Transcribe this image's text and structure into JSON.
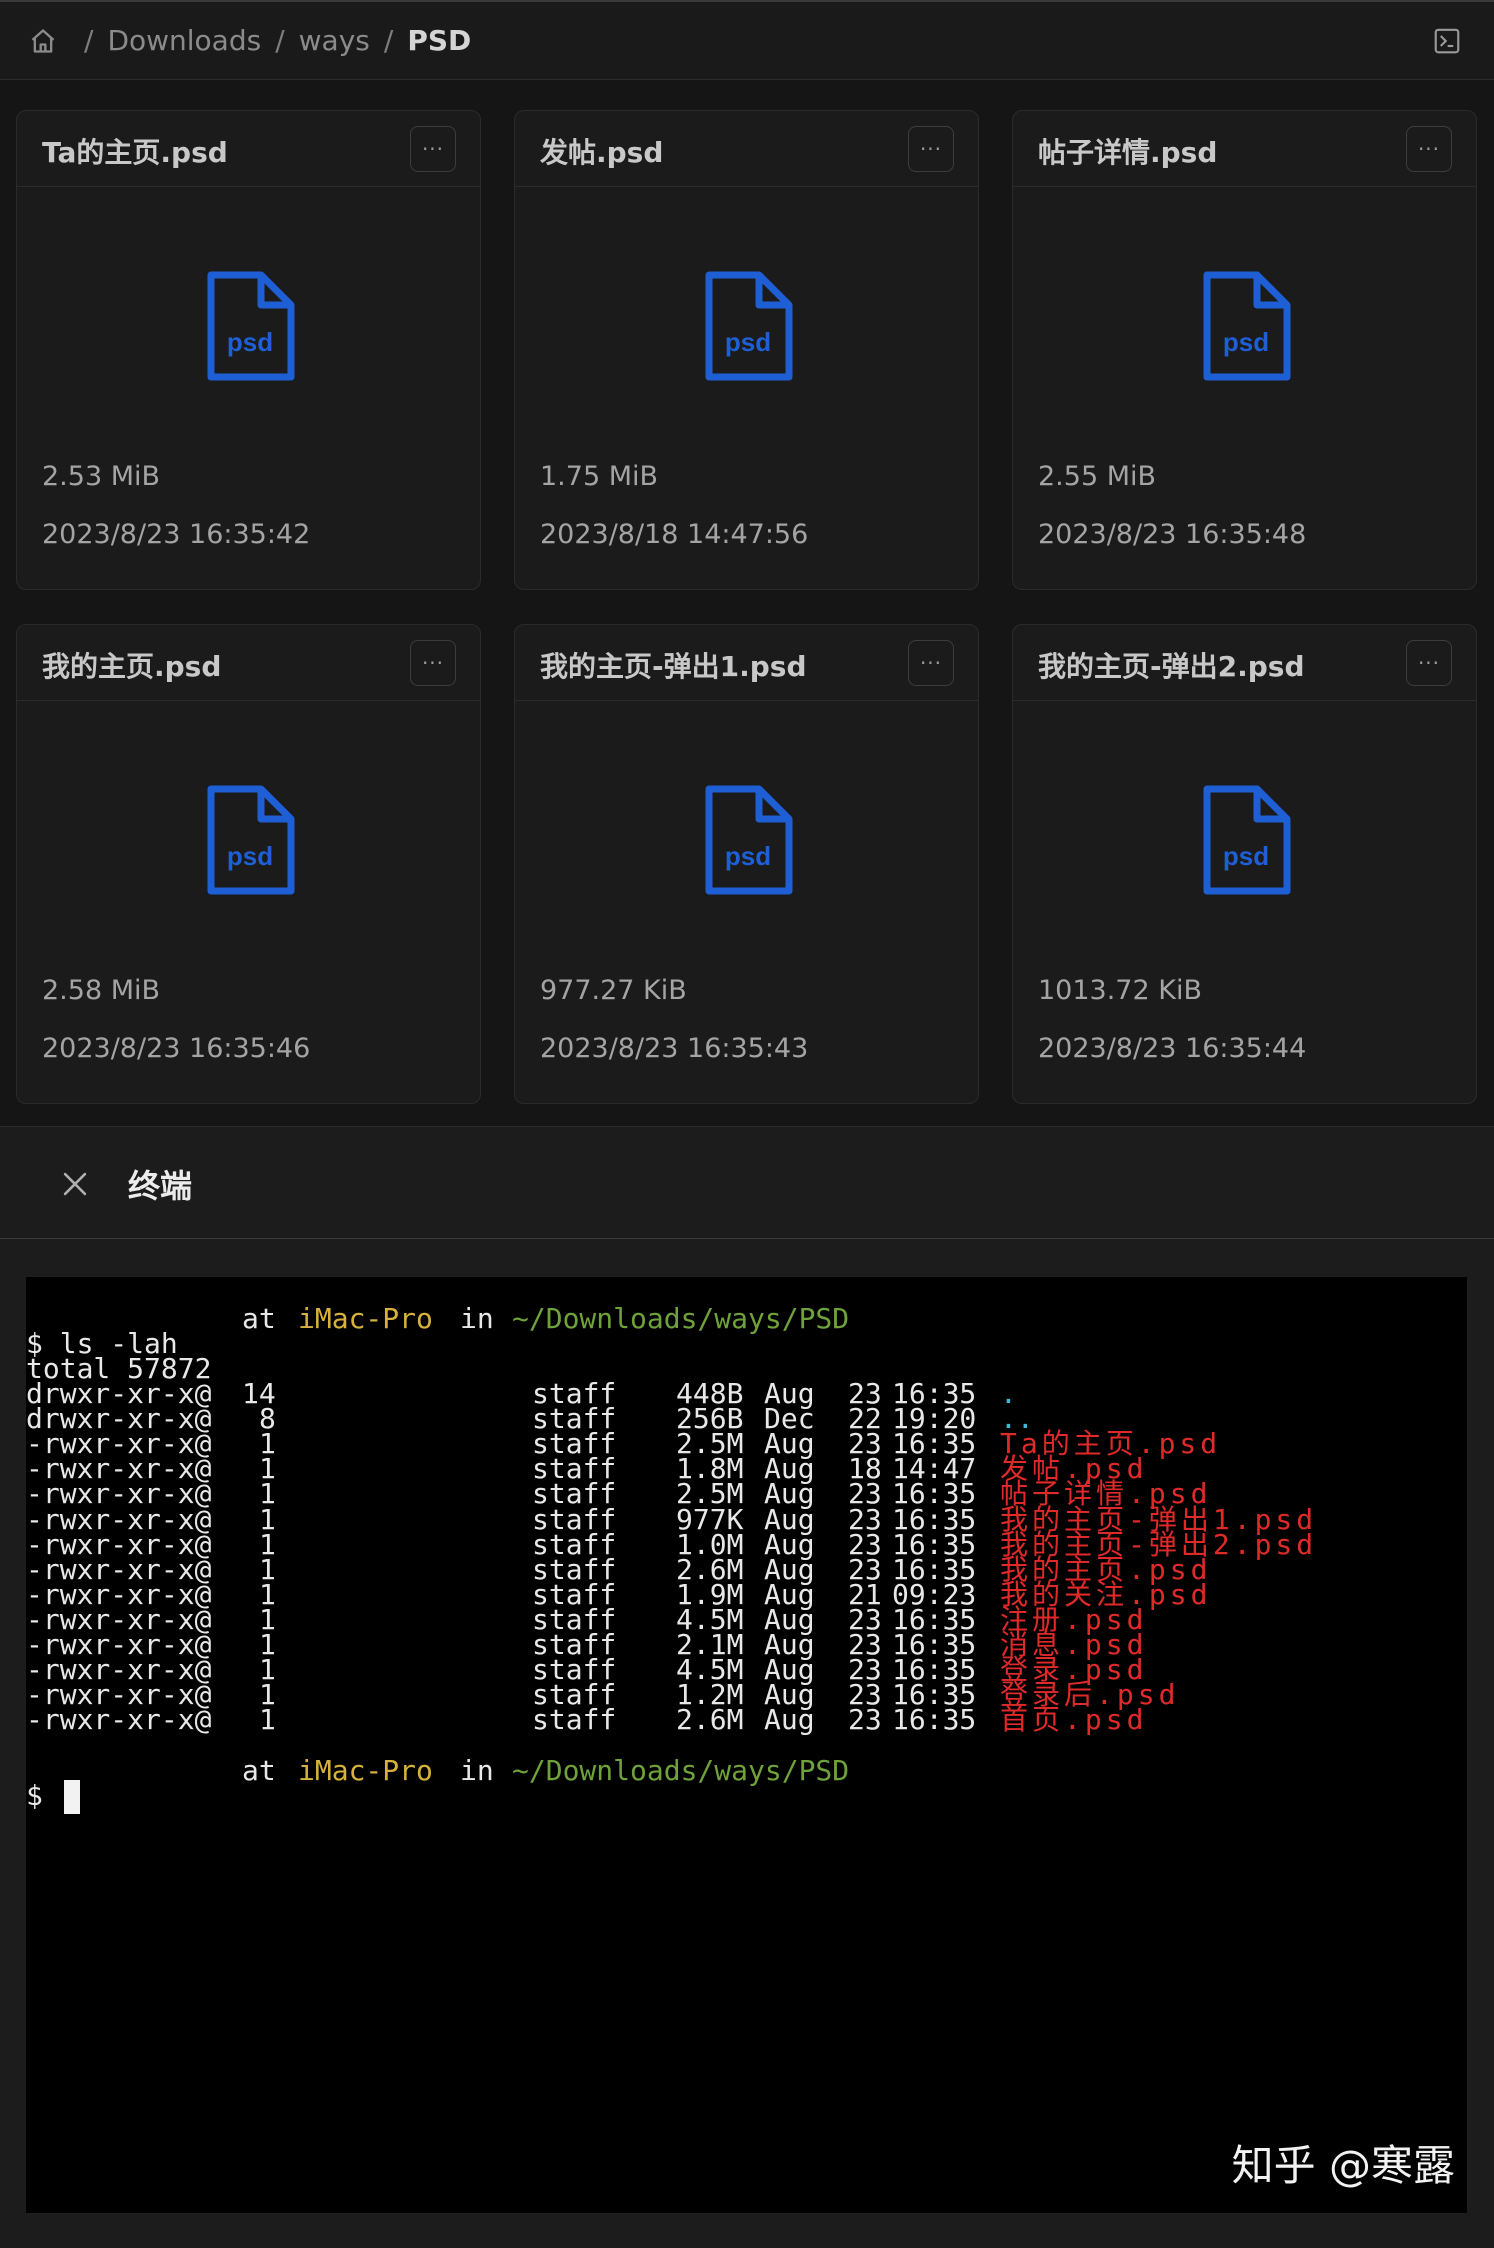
{
  "breadcrumb": {
    "separator": "/",
    "items": [
      "Downloads",
      "ways",
      "PSD"
    ]
  },
  "files": [
    {
      "name": "Ta的主页.psd",
      "size": "2.53 MiB",
      "modified": "2023/8/23 16:35:42",
      "icon": "psd"
    },
    {
      "name": "发帖.psd",
      "size": "1.75 MiB",
      "modified": "2023/8/18 14:47:56",
      "icon": "psd"
    },
    {
      "name": "帖子详情.psd",
      "size": "2.55 MiB",
      "modified": "2023/8/23 16:35:48",
      "icon": "psd"
    },
    {
      "name": "我的主页.psd",
      "size": "2.58 MiB",
      "modified": "2023/8/23 16:35:46",
      "icon": "psd"
    },
    {
      "name": "我的主页-弹出1.psd",
      "size": "977.27 KiB",
      "modified": "2023/8/23 16:35:43",
      "icon": "psd"
    },
    {
      "name": "我的主页-弹出2.psd",
      "size": "1013.72 KiB",
      "modified": "2023/8/23 16:35:44",
      "icon": "psd"
    }
  ],
  "card_menu_label": "···",
  "terminal": {
    "title": "终端",
    "prompt": {
      "at": "at",
      "host": "iMac-Pro",
      "in": "in",
      "path": "~/Downloads/ways/PSD"
    },
    "command_line": "$ ls -lah",
    "total": "total 57872",
    "rows": [
      {
        "perm": "drwxr-xr-x@",
        "links": "14",
        "group": "staff",
        "size": "448B",
        "month": "Aug",
        "day": "23",
        "time": "16:35",
        "name": "."
      },
      {
        "perm": "drwxr-xr-x@",
        "links": "8",
        "group": "staff",
        "size": "256B",
        "month": "Dec",
        "day": "22",
        "time": "19:20",
        "name": ".."
      },
      {
        "perm": "-rwxr-xr-x@",
        "links": "1",
        "group": "staff",
        "size": "2.5M",
        "month": "Aug",
        "day": "23",
        "time": "16:35",
        "name": "Ta的主页.psd"
      },
      {
        "perm": "-rwxr-xr-x@",
        "links": "1",
        "group": "staff",
        "size": "1.8M",
        "month": "Aug",
        "day": "18",
        "time": "14:47",
        "name": "发帖.psd"
      },
      {
        "perm": "-rwxr-xr-x@",
        "links": "1",
        "group": "staff",
        "size": "2.5M",
        "month": "Aug",
        "day": "23",
        "time": "16:35",
        "name": "帖子详情.psd"
      },
      {
        "perm": "-rwxr-xr-x@",
        "links": "1",
        "group": "staff",
        "size": "977K",
        "month": "Aug",
        "day": "23",
        "time": "16:35",
        "name": "我的主页-弹出1.psd"
      },
      {
        "perm": "-rwxr-xr-x@",
        "links": "1",
        "group": "staff",
        "size": "1.0M",
        "month": "Aug",
        "day": "23",
        "time": "16:35",
        "name": "我的主页-弹出2.psd"
      },
      {
        "perm": "-rwxr-xr-x@",
        "links": "1",
        "group": "staff",
        "size": "2.6M",
        "month": "Aug",
        "day": "23",
        "time": "16:35",
        "name": "我的主页.psd"
      },
      {
        "perm": "-rwxr-xr-x@",
        "links": "1",
        "group": "staff",
        "size": "1.9M",
        "month": "Aug",
        "day": "21",
        "time": "09:23",
        "name": "我的关注.psd"
      },
      {
        "perm": "-rwxr-xr-x@",
        "links": "1",
        "group": "staff",
        "size": "4.5M",
        "month": "Aug",
        "day": "23",
        "time": "16:35",
        "name": "注册.psd"
      },
      {
        "perm": "-rwxr-xr-x@",
        "links": "1",
        "group": "staff",
        "size": "2.1M",
        "month": "Aug",
        "day": "23",
        "time": "16:35",
        "name": "消息.psd"
      },
      {
        "perm": "-rwxr-xr-x@",
        "links": "1",
        "group": "staff",
        "size": "4.5M",
        "month": "Aug",
        "day": "23",
        "time": "16:35",
        "name": "登录.psd"
      },
      {
        "perm": "-rwxr-xr-x@",
        "links": "1",
        "group": "staff",
        "size": "1.2M",
        "month": "Aug",
        "day": "23",
        "time": "16:35",
        "name": "登录后.psd"
      },
      {
        "perm": "-rwxr-xr-x@",
        "links": "1",
        "group": "staff",
        "size": "2.6M",
        "month": "Aug",
        "day": "23",
        "time": "16:35",
        "name": "首页.psd"
      }
    ],
    "input_prompt": "$"
  },
  "watermark": "知乎 @寒露",
  "colors": {
    "psd_icon": "#1f5fd6",
    "host": "#d6b23a",
    "path": "#6fa23a",
    "dir": "#3fbad2",
    "file": "#e02a2a"
  }
}
